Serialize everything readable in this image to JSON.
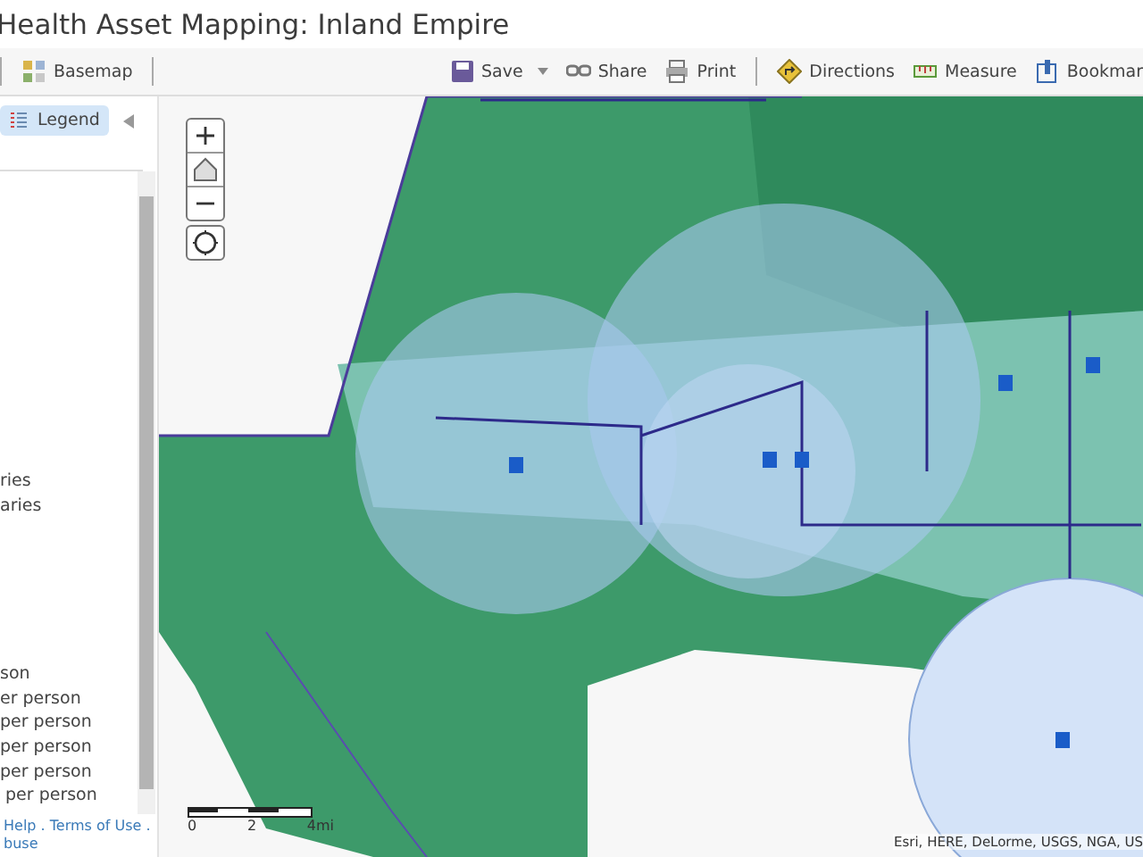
{
  "window": {
    "title": "Health Asset Mapping: Inland Empire"
  },
  "toolbar": {
    "left": [
      {
        "kind": "basemap",
        "label": "Basemap"
      }
    ],
    "right": [
      {
        "kind": "save",
        "label": "Save",
        "caret": true
      },
      {
        "kind": "share",
        "label": "Share",
        "caret": false
      },
      {
        "kind": "print",
        "label": "Print",
        "caret": false
      },
      {
        "kind": "directions",
        "label": "Directions",
        "caret": false
      },
      {
        "kind": "measure",
        "label": "Measure",
        "caret": false
      },
      {
        "kind": "bookmark",
        "label": "Bookmar",
        "caret": false
      }
    ]
  },
  "sidebar": {
    "tabs": [
      {
        "label": "Legend",
        "selected": true
      }
    ],
    "legend_groups": [
      [
        "ries",
        "aries"
      ],
      [
        "son",
        "er person",
        "per person",
        "per person",
        "per person",
        " per person"
      ]
    ],
    "footer": [
      "Help . Terms of Use .",
      "buse"
    ]
  },
  "map": {
    "scale_labels": [
      "0",
      "2",
      "4mi"
    ],
    "attribution": "Esri, HERE, DeLorme, USGS, NGA, US"
  }
}
